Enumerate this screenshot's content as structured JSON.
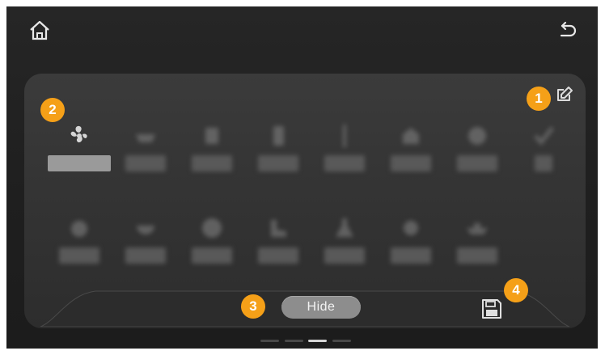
{
  "header": {
    "home_icon": "home-icon",
    "back_icon": "back-arrow-icon"
  },
  "grid": {
    "row1": [
      {
        "icon": "fan-icon",
        "selected": true
      },
      {
        "icon": "pot-icon"
      },
      {
        "icon": "grill-icon"
      },
      {
        "icon": "cup-icon"
      },
      {
        "icon": "probe-icon"
      },
      {
        "icon": "oven-icon"
      },
      {
        "icon": "cake-icon"
      },
      {
        "icon": "check-icon"
      }
    ],
    "row2": [
      {
        "icon": "bag-icon"
      },
      {
        "icon": "bowl-icon"
      },
      {
        "icon": "pizza-icon"
      },
      {
        "icon": "boot-icon"
      },
      {
        "icon": "flask-icon"
      },
      {
        "icon": "gear-icon"
      },
      {
        "icon": "kettle-icon"
      }
    ]
  },
  "edit_icon": "edit-icon",
  "dock": {
    "hide_label": "Hide",
    "save_icon": "save-icon"
  },
  "badges": {
    "b1": "1",
    "b2": "2",
    "b3": "3",
    "b4": "4"
  },
  "pager": {
    "pages": 4,
    "active_index": 2
  },
  "colors": {
    "accent": "#f5a018",
    "background": "#262626",
    "panel": "#383838"
  }
}
